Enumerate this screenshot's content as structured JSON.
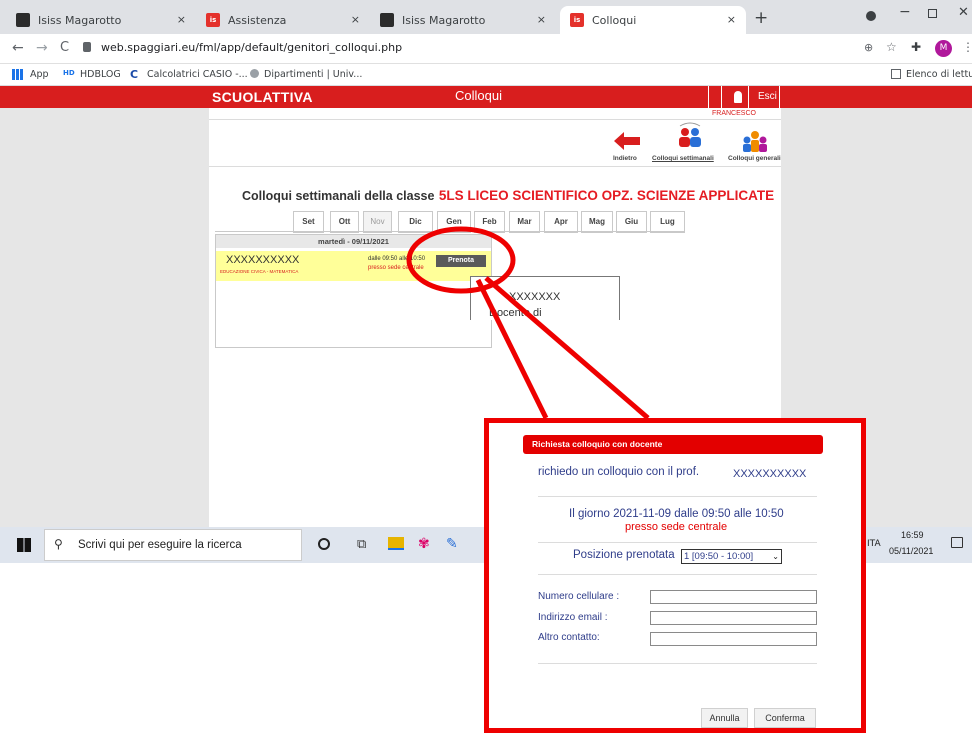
{
  "browser": {
    "tabs": [
      {
        "title": "Isiss Magarotto",
        "favicon_color": "#2b2b2b"
      },
      {
        "title": "Assistenza",
        "favicon_color": "#e4312b"
      },
      {
        "title": "Isiss Magarotto",
        "favicon_color": "#2b2b2b"
      },
      {
        "title": "Colloqui",
        "favicon_color": "#e4312b"
      }
    ],
    "new_tab": "+",
    "close_tab": "×",
    "url": "web.spaggiari.eu/fml/app/default/genitori_colloqui.php",
    "bookmarks": [
      {
        "label": "App"
      },
      {
        "label": "HDBLOG"
      },
      {
        "label": "Calcolatrici CASIO -..."
      },
      {
        "label": "Dipartimenti | Univ..."
      }
    ],
    "reading_list": "Elenco di lettura",
    "profile_initial": "M"
  },
  "header": {
    "brand": "SCUOLATTIVA",
    "title": "Colloqui",
    "logout": "Esci",
    "user": "FRANCESCO",
    "bar_color": "#d81e1e"
  },
  "nav": {
    "back": "Indietro",
    "weekly": "Colloqui settimanali",
    "general": "Colloqui generali"
  },
  "page": {
    "heading_prefix": "Colloqui settimanali della classe",
    "heading_class": "5LS LICEO SCIENTIFICO OPZ. SCIENZE APPLICATE"
  },
  "months": [
    "Set",
    "Ott",
    "Nov",
    "Dic",
    "Gen",
    "Feb",
    "Mar",
    "Apr",
    "Mag",
    "Giu",
    "Lug"
  ],
  "day": {
    "date": "martedì - 09/11/2021",
    "teacher": "XXXXXXXXXX",
    "subject": "EDUCAZIONE CIVICA - MATEMATICA",
    "time": "dalle 09:50 alle 10:50",
    "place": "presso sede centrale",
    "book_button": "Prenota"
  },
  "tooltip": {
    "name": "XXXXXXX",
    "role": "Docente di"
  },
  "taskbar": {
    "search_placeholder": "Scrivi qui per eseguire la ricerca",
    "time": "16:59",
    "date": "05/11/2021",
    "lang": "ITA"
  },
  "dialog": {
    "title": "Richiesta colloquio con docente",
    "request_text": "richiedo un colloquio con il prof.",
    "teacher": "XXXXXXXXXX",
    "day_text": "Il giorno 2021-11-09 dalle 09:50 alle 10:50",
    "place_text": "presso sede centrale",
    "position_label": "Posizione prenotata",
    "position_value": "1 [09:50 - 10:00]",
    "phone_label": "Numero cellulare :",
    "email_label": "Indirizzo email :",
    "other_label": "Altro contatto:",
    "cancel": "Annulla",
    "confirm": "Conferma"
  },
  "colors": {
    "annotation": "#ee0000",
    "highlight_row": "#ffff99",
    "link_blue": "#2f3d8a"
  }
}
